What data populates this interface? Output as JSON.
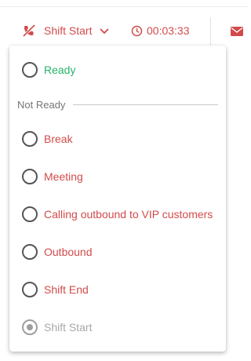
{
  "header": {
    "status_label": "Shift Start",
    "timer": "00:03:33"
  },
  "menu": {
    "ready_label": "Ready",
    "section_label": "Not Ready",
    "not_ready_items": [
      {
        "label": "Break"
      },
      {
        "label": "Meeting"
      },
      {
        "label": "Calling outbound to VIP customers"
      },
      {
        "label": "Outbound"
      },
      {
        "label": "Shift End"
      }
    ],
    "current_label": "Shift Start",
    "selected": "Shift Start"
  },
  "icons": {
    "status": "phone-slash-icon",
    "dropdown": "chevron-down-icon",
    "timer": "clock-icon",
    "mail": "mail-icon"
  },
  "colors": {
    "ready": "#27b46b",
    "not_ready": "#d24b4b",
    "disabled": "#a8a8a8"
  }
}
